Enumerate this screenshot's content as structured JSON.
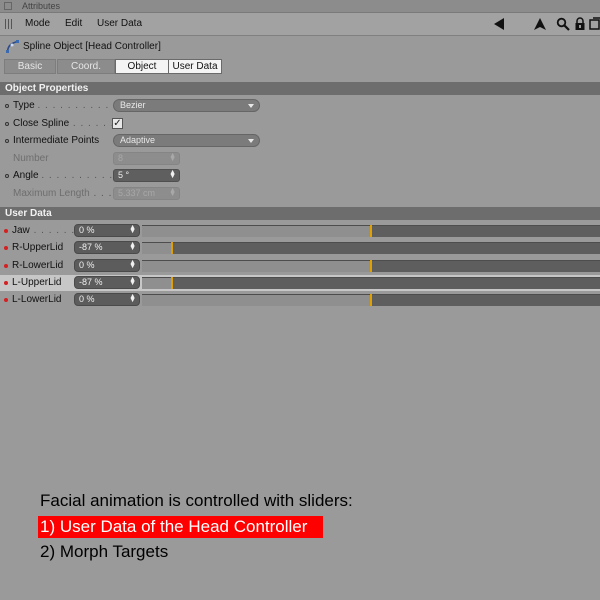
{
  "window": {
    "title": "Attributes"
  },
  "menu": {
    "items": [
      "Mode",
      "Edit",
      "User Data"
    ]
  },
  "object": {
    "title": "Spline Object [Head Controller]"
  },
  "tabs": [
    "Basic",
    "Coord.",
    "Object",
    "User Data"
  ],
  "active_tab": "Object",
  "object_properties": {
    "header": "Object Properties",
    "type": {
      "label": "Type",
      "value": "Bezier"
    },
    "close_spline": {
      "label": "Close Spline",
      "checked": true,
      "mark": "✓"
    },
    "intermediate_points": {
      "label": "Intermediate Points",
      "value": "Adaptive"
    },
    "number": {
      "label": "Number",
      "value": "8"
    },
    "angle": {
      "label": "Angle",
      "value": "5 °"
    },
    "maximum_length": {
      "label": "Maximum Length",
      "value": "5.337 cm"
    }
  },
  "user_data": {
    "header": "User Data",
    "sliders": [
      {
        "label": "Jaw",
        "value": "0 %",
        "percent": 0,
        "highlight": false
      },
      {
        "label": "R-UpperLid",
        "value": "-87 %",
        "percent": -87,
        "highlight": false
      },
      {
        "label": "R-LowerLid",
        "value": "0 %",
        "percent": 0,
        "highlight": false
      },
      {
        "label": "L-UpperLid",
        "value": "-87 %",
        "percent": -87,
        "highlight": true
      },
      {
        "label": "L-LowerLid",
        "value": "0 %",
        "percent": 0,
        "highlight": false
      }
    ],
    "slider_range": [
      -100,
      100
    ]
  },
  "captions": {
    "line1": "Facial animation is controlled with sliders:",
    "line2": "1) User Data of the Head Controller",
    "line3": "2) Morph Targets"
  },
  "colors": {
    "knob": "#e0a000",
    "highlight_caption_bg": "#ff0000",
    "user_data_dot": "#d42020"
  },
  "icons": [
    "back-arrow-icon",
    "pointer-icon",
    "search-icon",
    "lock-icon",
    "new-panel-icon",
    "spline-object-icon"
  ]
}
